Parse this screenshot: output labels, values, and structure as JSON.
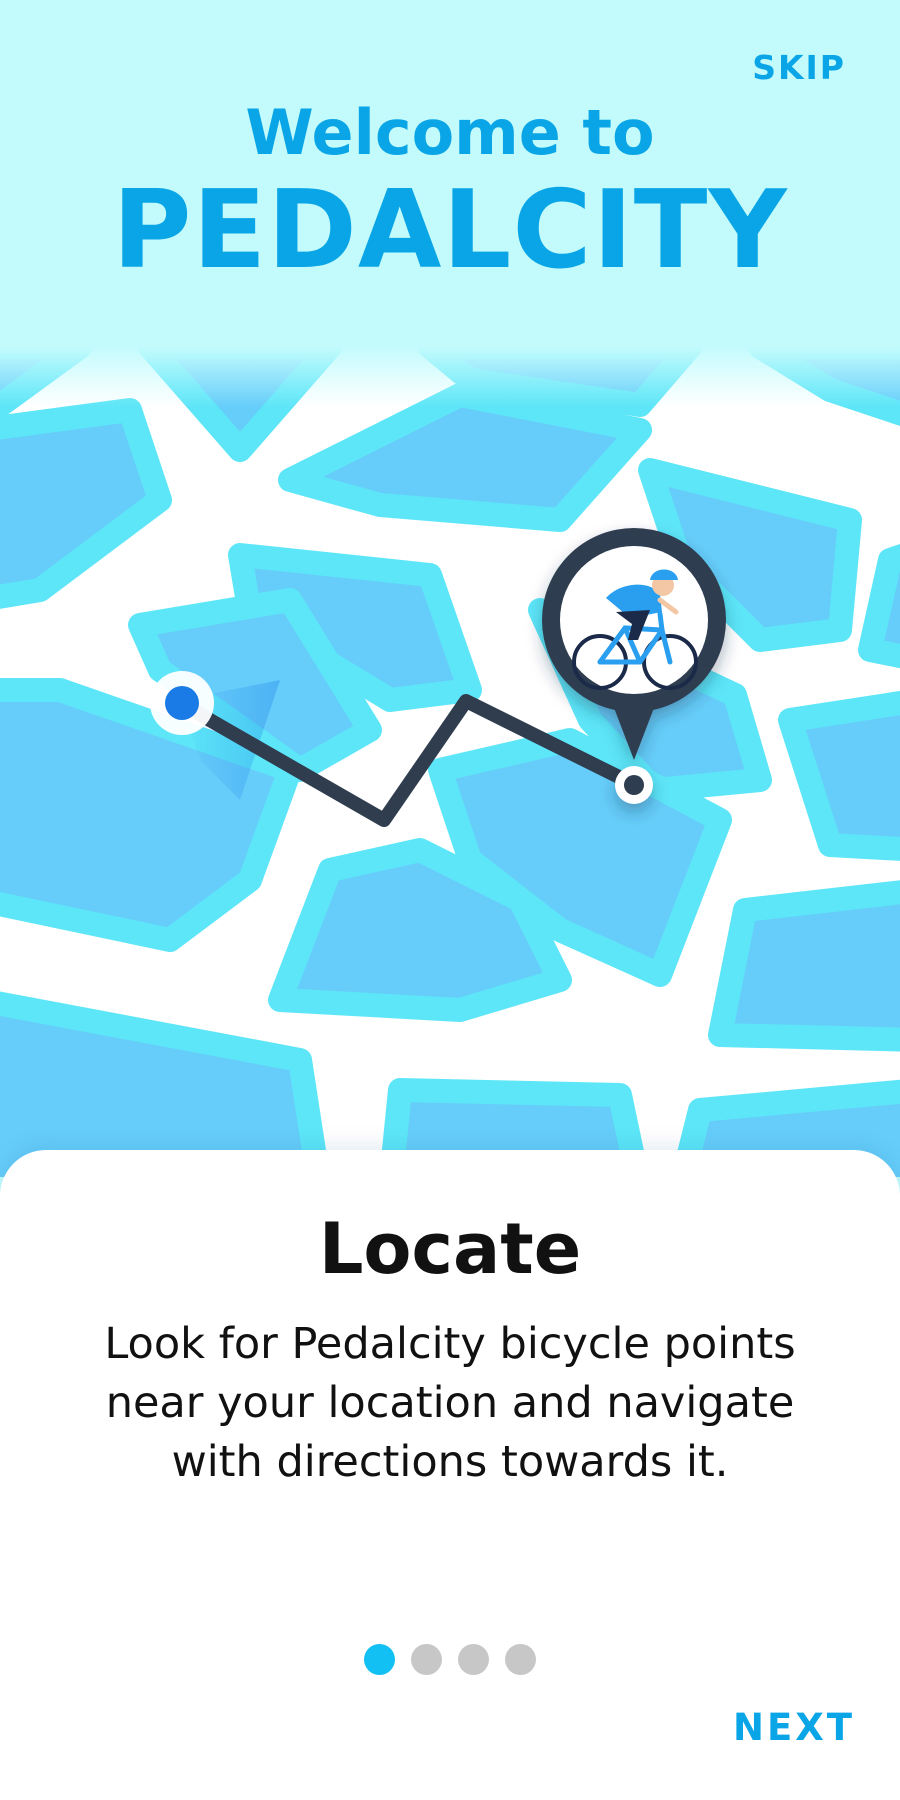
{
  "header": {
    "skip_label": "SKIP",
    "welcome_text": "Welcome to",
    "brand_name": "PEDALCITY"
  },
  "colors": {
    "accent": "#0aa5e6",
    "header_bg": "#c3fbfd",
    "map_block": "#66cdfa",
    "map_block_edge": "#5de6f8",
    "route": "#2f3d4f",
    "start_marker": "#1a7be6",
    "active_dot": "#12c0f4",
    "inactive_dot": "#c7c7c7"
  },
  "map": {
    "start_marker_icon": "location-dot-icon",
    "destination_icon": "cyclist-pin-icon"
  },
  "card": {
    "title": "Locate",
    "description": "Look for Pedalcity bicycle points near your location and navigate with directions towards it."
  },
  "pagination": {
    "total": 4,
    "active_index": 0
  },
  "footer": {
    "next_label": "NEXT"
  }
}
